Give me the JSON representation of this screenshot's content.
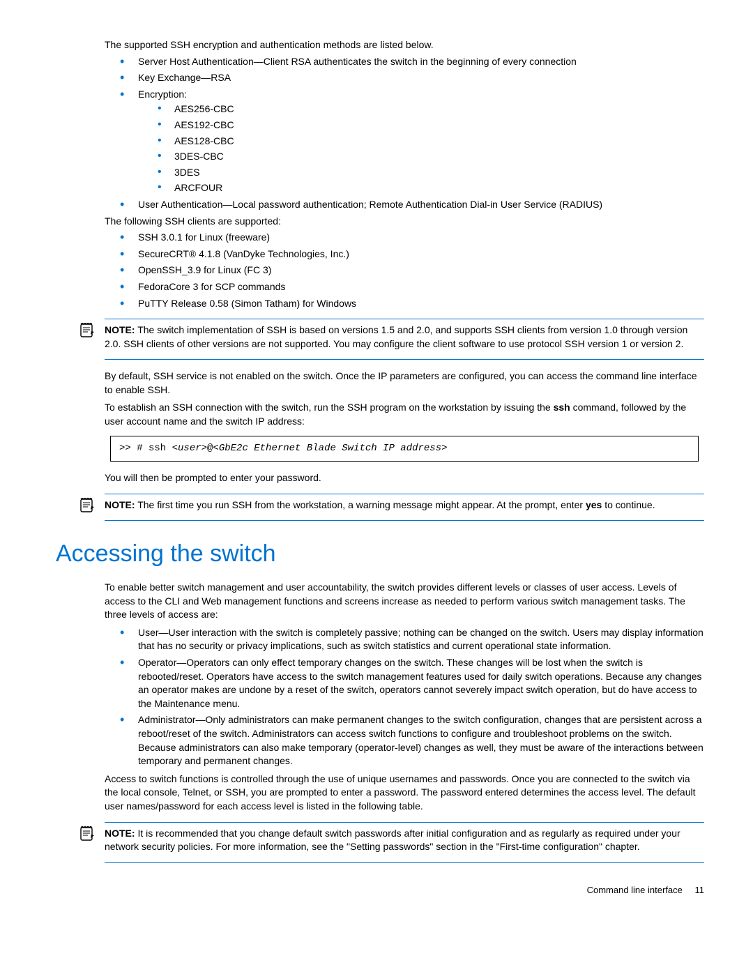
{
  "intro": "The supported SSH encryption and authentication methods are listed below.",
  "methods": {
    "server_host": "Server Host Authentication—Client RSA authenticates the switch in the beginning of every connection",
    "key_exchange": "Key Exchange—RSA",
    "encryption_label": "Encryption:",
    "encryption_items": [
      "AES256-CBC",
      "AES192-CBC",
      "AES128-CBC",
      "3DES-CBC",
      "3DES",
      "ARCFOUR"
    ],
    "user_auth": "User Authentication—Local password authentication; Remote Authentication Dial-in User Service (RADIUS)"
  },
  "clients_intro": "The following SSH clients are supported:",
  "clients": [
    "SSH 3.0.1 for Linux (freeware)",
    "SecureCRT® 4.1.8 (VanDyke Technologies, Inc.)",
    "OpenSSH_3.9 for Linux (FC 3)",
    "FedoraCore 3 for SCP commands",
    "PuTTY Release 0.58 (Simon Tatham) for Windows"
  ],
  "note1": {
    "label": "NOTE:",
    "body": "  The switch implementation of SSH is based on versions 1.5 and 2.0, and supports SSH clients from version 1.0 through version 2.0. SSH clients of other versions are not supported. You may configure the client software to use protocol SSH version 1 or version 2."
  },
  "para1": "By default, SSH service is not enabled on the switch. Once the IP parameters are configured, you can access the command line interface to enable SSH.",
  "para2_a": "To establish an SSH connection with the switch, run the SSH program on the workstation by issuing the ",
  "para2_bold": "ssh",
  "para2_b": " command, followed by the user account name and the switch IP address:",
  "code_parts": {
    "p1": ">> # ssh <",
    "p2": "user",
    "p3": ">@<",
    "p4": "GbE2c Ethernet Blade Switch IP address",
    "p5": ">"
  },
  "para3": "You will then be prompted to enter your password.",
  "note2": {
    "label": "NOTE:",
    "body_a": "  The first time you run SSH from the workstation, a warning message might appear. At the prompt, enter ",
    "bold": "yes",
    "body_b": " to continue."
  },
  "heading": "Accessing the switch",
  "access_intro": "To enable better switch management and user accountability, the switch provides different levels or classes of user access. Levels of access to the CLI and Web management functions and screens increase as needed to perform various switch management tasks. The three levels of access are:",
  "access_levels": [
    "User—User interaction with the switch is completely passive; nothing can be changed on the switch. Users may display information that has no security or privacy implications, such as switch statistics and current operational state information.",
    "Operator—Operators can only effect temporary changes on the switch. These changes will be lost when the switch is rebooted/reset. Operators have access to the switch management features used for daily switch operations. Because any changes an operator makes are undone by a reset of the switch, operators cannot severely impact switch operation, but do have access to the Maintenance menu.",
    "Administrator—Only administrators can make permanent changes to the switch configuration, changes that are persistent across a reboot/reset of the switch. Administrators can access switch functions to configure and troubleshoot problems on the switch. Because administrators can also make temporary (operator-level) changes as well, they must be aware of the interactions between temporary and permanent changes."
  ],
  "access_footer": "Access to switch functions is controlled through the use of unique usernames and passwords. Once you are connected to the switch via the local console, Telnet, or SSH, you are prompted to enter a password. The password entered determines the access level. The default user names/password for each access level is listed in the following table.",
  "note3": {
    "label": "NOTE:",
    "body": "  It is recommended that you change default switch passwords after initial configuration and as regularly as required under your network security policies. For more information, see the \"Setting passwords\" section in the \"First-time configuration\" chapter."
  },
  "footer": {
    "section": "Command line interface",
    "page": "11"
  }
}
